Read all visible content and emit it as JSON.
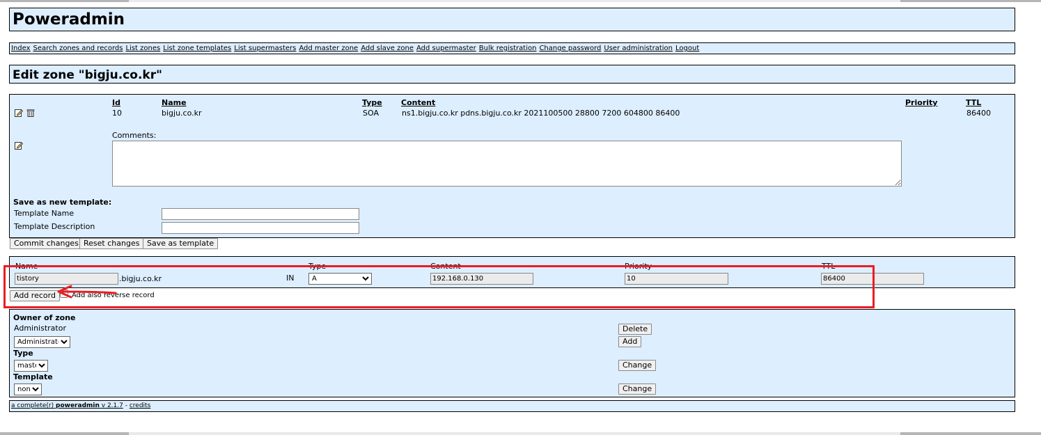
{
  "app": {
    "title": "Poweradmin"
  },
  "menu": {
    "items": [
      "Index",
      "Search zones and records",
      "List zones",
      "List zone templates",
      "List supermasters",
      "Add master zone",
      "Add slave zone",
      "Add supermaster",
      "Bulk registration",
      "Change password",
      "User administration",
      "Logout"
    ]
  },
  "page": {
    "heading": "Edit zone \"bigju.co.kr\""
  },
  "records_table": {
    "headers": {
      "id": "Id",
      "name": "Name",
      "type": "Type",
      "content": "Content",
      "priority": "Priority",
      "ttl": "TTL"
    },
    "rows": [
      {
        "id": "10",
        "name": "bigju.co.kr",
        "type": "SOA",
        "content": "ns1.bigju.co.kr pdns.bigju.co.kr 2021100500 28800 7200 604800 86400",
        "priority": "",
        "ttl": "86400"
      }
    ],
    "icons": {
      "edit": "edit-icon",
      "delete": "delete-icon"
    }
  },
  "comments": {
    "label": "Comments:",
    "value": ""
  },
  "template": {
    "heading": "Save as new template:",
    "name_label": "Template Name",
    "name_value": "",
    "description_label": "Template Description",
    "description_value": ""
  },
  "actions": {
    "commit": "Commit changes",
    "reset": "Reset changes",
    "save_template": "Save as template"
  },
  "add_record": {
    "headers": {
      "name": "Name",
      "type": "Type",
      "content": "Content",
      "priority": "Priority",
      "ttl": "TTL"
    },
    "name_value": "tistory",
    "zone_suffix": ".bigju.co.kr",
    "class": "IN",
    "type_selected": "A",
    "content_value": "192.168.0.130",
    "priority_value": "10",
    "ttl_value": "86400",
    "button": "Add record",
    "reverse_label": "Add also reverse record"
  },
  "owner": {
    "heading": "Owner of zone",
    "current_owner": "Administrator",
    "select_value": "Administrator",
    "delete_button": "Delete",
    "add_button": "Add",
    "type_heading": "Type",
    "type_value": "master",
    "type_change": "Change",
    "template_heading": "Template",
    "template_value": "none",
    "template_change": "Change"
  },
  "footer": {
    "prefix": "a complete(r)",
    "brand": "poweradmin",
    "version": "v 2.1.7",
    "separator": "-",
    "credits": "credits"
  },
  "annotation": {
    "highlight_color": "#ea1c24"
  },
  "colors": {
    "panel_bg": "#ddeeff",
    "border": "#000000"
  }
}
